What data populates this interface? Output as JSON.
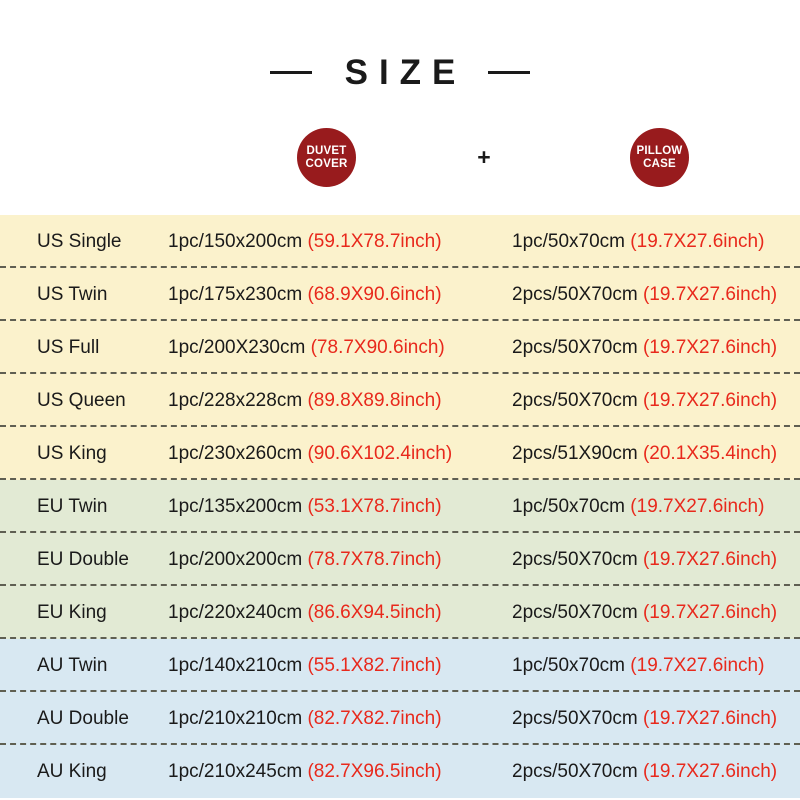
{
  "header": {
    "title": "SIZE",
    "badges": [
      {
        "name": "duvet-cover",
        "line1": "DUVET",
        "line2": "COVER"
      },
      {
        "name": "pillow-case",
        "line1": "PILLOW",
        "line2": "CASE"
      }
    ],
    "separator_symbol": "+"
  },
  "colors": {
    "badge_red": "#981b1d",
    "inch_red": "#e8291c",
    "band_us": "#fbf2cc",
    "band_eu": "#e2ead4",
    "band_au": "#d8e8f2",
    "text_dark": "#1a1a1a"
  },
  "table": {
    "rows": [
      {
        "region": "us",
        "label": "US Single",
        "duvet_cm": "1pc/150x200cm",
        "duvet_inch": "(59.1X78.7inch)",
        "pillow_cm": "1pc/50x70cm",
        "pillow_inch": "(19.7X27.6inch)"
      },
      {
        "region": "us",
        "label": "US Twin",
        "duvet_cm": "1pc/175x230cm",
        "duvet_inch": "(68.9X90.6inch)",
        "pillow_cm": "2pcs/50X70cm",
        "pillow_inch": "(19.7X27.6inch)"
      },
      {
        "region": "us",
        "label": "US Full",
        "duvet_cm": "1pc/200X230cm",
        "duvet_inch": "(78.7X90.6inch)",
        "pillow_cm": "2pcs/50X70cm",
        "pillow_inch": "(19.7X27.6inch)"
      },
      {
        "region": "us",
        "label": "US Queen",
        "duvet_cm": "1pc/228x228cm",
        "duvet_inch": "(89.8X89.8inch)",
        "pillow_cm": "2pcs/50X70cm",
        "pillow_inch": "(19.7X27.6inch)"
      },
      {
        "region": "us",
        "label": "US King",
        "duvet_cm": "1pc/230x260cm",
        "duvet_inch": "(90.6X102.4inch)",
        "pillow_cm": "2pcs/51X90cm",
        "pillow_inch": "(20.1X35.4inch)"
      },
      {
        "region": "eu",
        "label": "EU Twin",
        "duvet_cm": "1pc/135x200cm",
        "duvet_inch": "(53.1X78.7inch)",
        "pillow_cm": "1pc/50x70cm",
        "pillow_inch": "(19.7X27.6inch)"
      },
      {
        "region": "eu",
        "label": "EU Double",
        "duvet_cm": "1pc/200x200cm",
        "duvet_inch": "(78.7X78.7inch)",
        "pillow_cm": "2pcs/50X70cm",
        "pillow_inch": "(19.7X27.6inch)"
      },
      {
        "region": "eu",
        "label": "EU King",
        "duvet_cm": "1pc/220x240cm",
        "duvet_inch": "(86.6X94.5inch)",
        "pillow_cm": "2pcs/50X70cm",
        "pillow_inch": "(19.7X27.6inch)"
      },
      {
        "region": "au",
        "label": "AU Twin",
        "duvet_cm": "1pc/140x210cm",
        "duvet_inch": "(55.1X82.7inch)",
        "pillow_cm": "1pc/50x70cm",
        "pillow_inch": "(19.7X27.6inch)"
      },
      {
        "region": "au",
        "label": "AU Double",
        "duvet_cm": "1pc/210x210cm",
        "duvet_inch": "(82.7X82.7inch)",
        "pillow_cm": "2pcs/50X70cm",
        "pillow_inch": "(19.7X27.6inch)"
      },
      {
        "region": "au",
        "label": "AU King",
        "duvet_cm": "1pc/210x245cm",
        "duvet_inch": "(82.7X96.5inch)",
        "pillow_cm": "2pcs/50X70cm",
        "pillow_inch": "(19.7X27.6inch)"
      }
    ]
  }
}
